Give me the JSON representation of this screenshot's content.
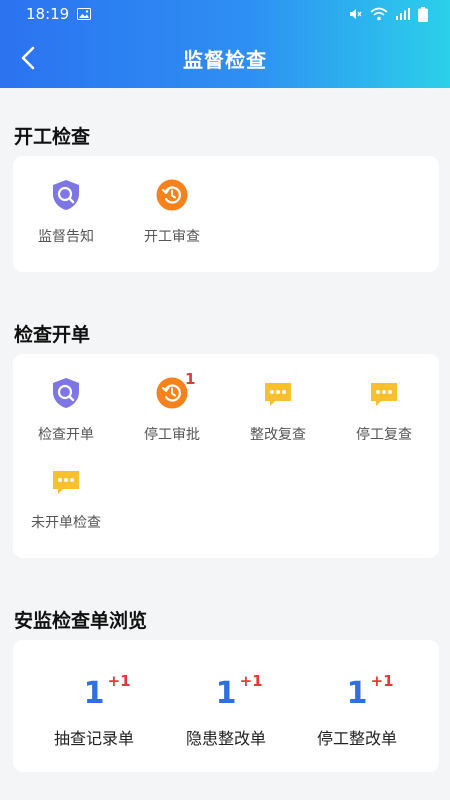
{
  "status_bar": {
    "time": "18:19"
  },
  "nav": {
    "title": "监督检查"
  },
  "sections": {
    "start_inspection": {
      "title": "开工检查",
      "items": [
        {
          "label": "监督告知",
          "icon": "shield-search-icon"
        },
        {
          "label": "开工审查",
          "icon": "clock-refresh-icon"
        }
      ]
    },
    "inspection_order": {
      "title": "检查开单",
      "items": [
        {
          "label": "检查开单",
          "icon": "shield-search-icon"
        },
        {
          "label": "停工审批",
          "icon": "clock-refresh-icon",
          "badge": "1"
        },
        {
          "label": "整改复查",
          "icon": "message-dots-icon"
        },
        {
          "label": "停工复查",
          "icon": "message-dots-icon"
        },
        {
          "label": "未开单检查",
          "icon": "message-dots-icon"
        }
      ]
    },
    "browse": {
      "title": "安监检查单浏览",
      "stats": [
        {
          "value": "1",
          "delta": "+1",
          "label": "抽查记录单"
        },
        {
          "value": "1",
          "delta": "+1",
          "label": "隐患整改单"
        },
        {
          "value": "1",
          "delta": "+1",
          "label": "停工整改单"
        }
      ]
    }
  },
  "colors": {
    "header_start": "#2b73f0",
    "header_end": "#2bd0ea",
    "accent_blue": "#2f6fe0",
    "badge_red": "#e53935",
    "shield_purple": "#7f76e6",
    "clock_orange": "#f7821b",
    "message_yellow": "#f8c02c"
  }
}
